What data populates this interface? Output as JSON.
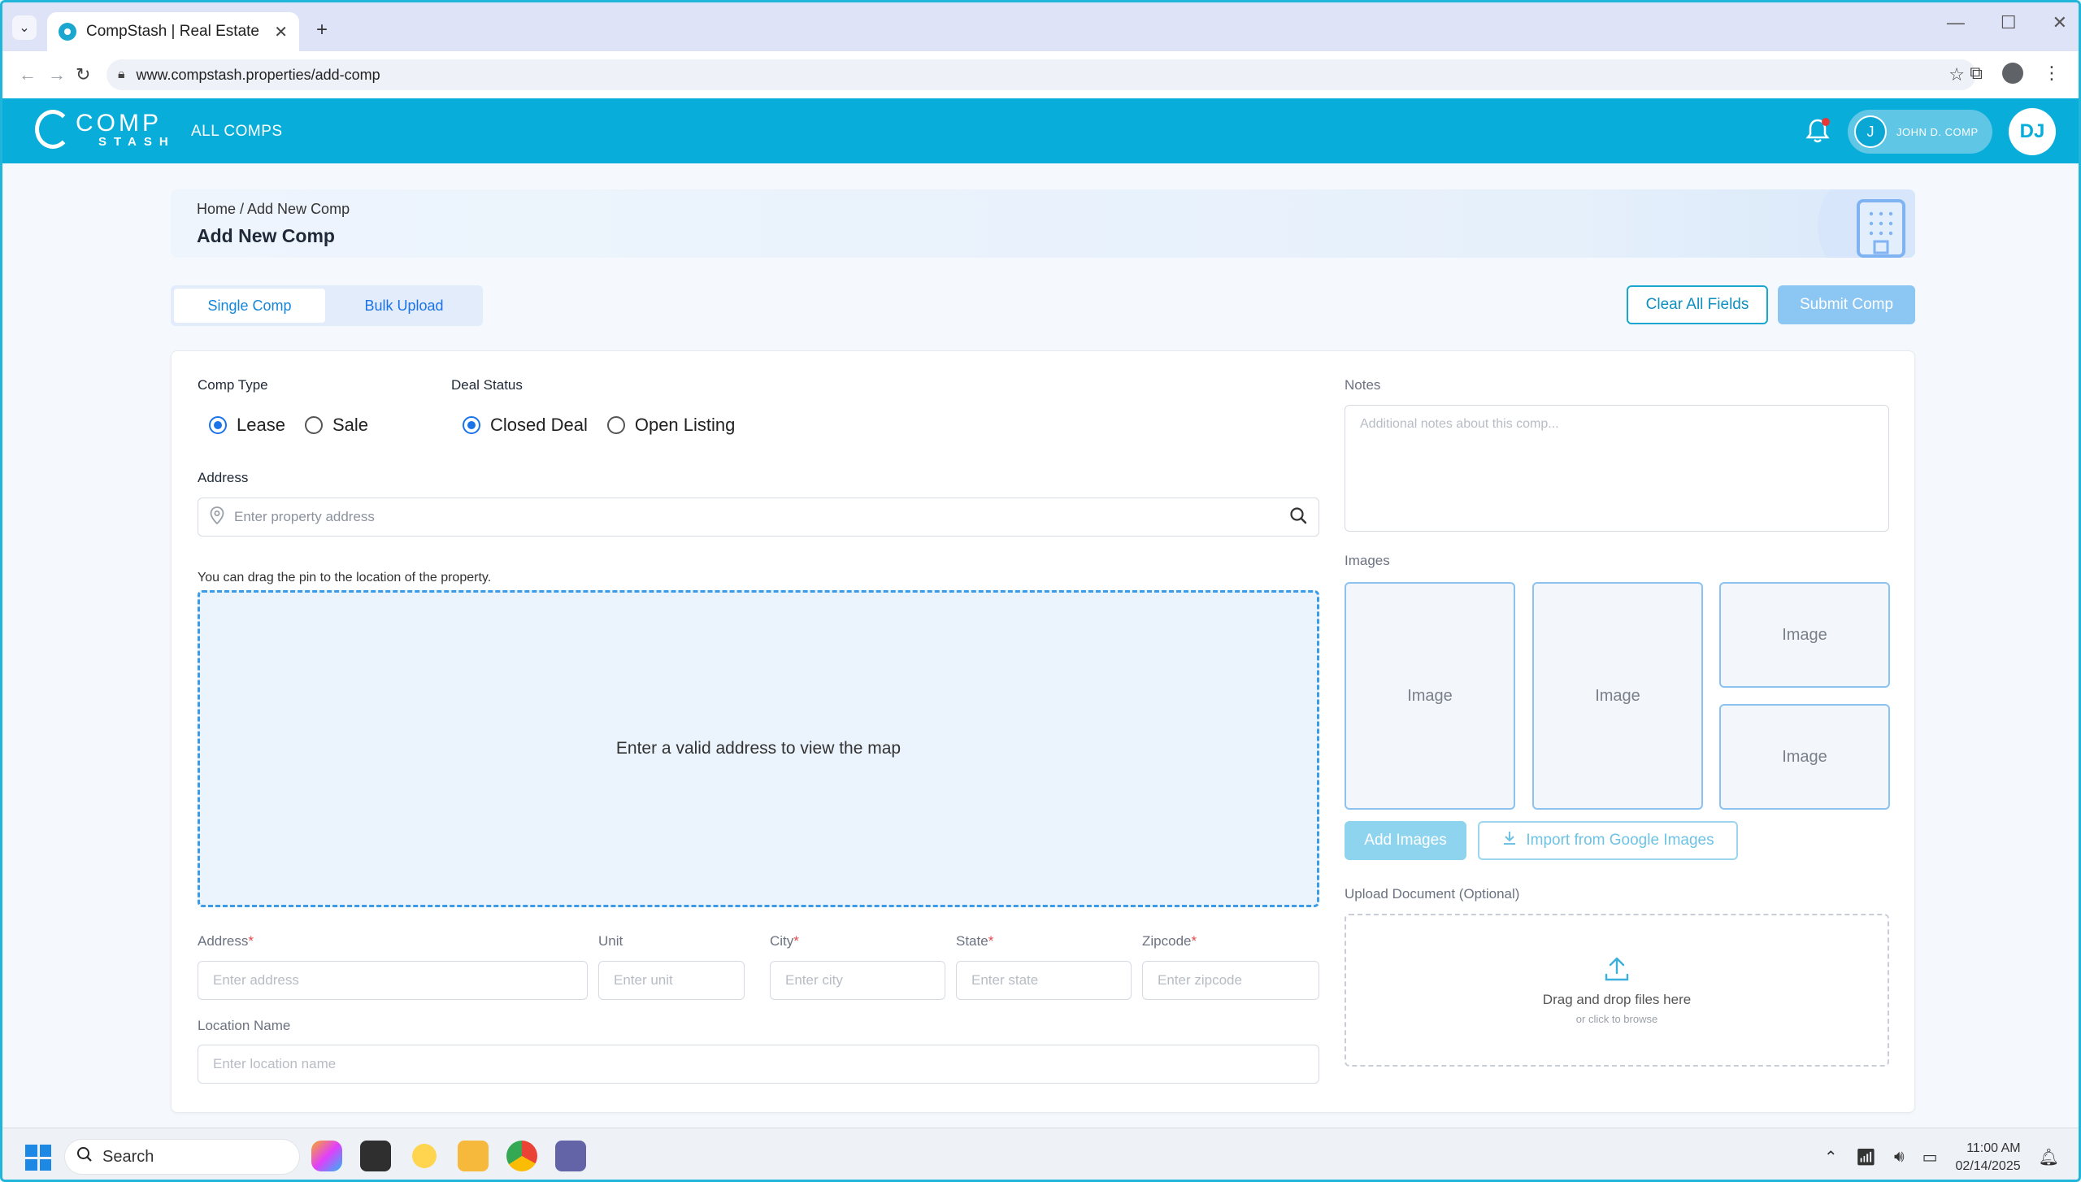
{
  "browser": {
    "tab_title": "CompStash | Real Estate",
    "url": "www.compstash.properties/add-comp"
  },
  "appbar": {
    "logo_top": "COMP",
    "logo_bottom": "STASH",
    "nav_all_comps": "ALL COMPS",
    "user_pill_initial": "J",
    "user_pill_name": "JOHN D. COMP",
    "avatar_initials": "DJ"
  },
  "page": {
    "breadcrumb": "Home / Add New Comp",
    "title": "Add New Comp"
  },
  "mode_toggle": {
    "single": "Single Comp",
    "bulk": "Bulk Upload",
    "active": "single"
  },
  "actions": {
    "clear": "Clear All Fields",
    "submit": "Submit Comp"
  },
  "form": {
    "comp_type_label": "Comp Type",
    "comp_type_options": [
      "Lease",
      "Sale"
    ],
    "comp_type_selected": "Lease",
    "deal_status_label": "Deal Status",
    "deal_status_options": [
      "Closed Deal",
      "Open Listing"
    ],
    "deal_status_selected": "Closed Deal",
    "address_label": "Address",
    "address_placeholder": "Enter property address",
    "map_hint": "You can drag the pin to the location of the property.",
    "map_placeholder": "Enter a valid address to view the map",
    "fields": {
      "address": {
        "label": "Address",
        "placeholder": "Enter address",
        "required": true
      },
      "unit": {
        "label": "Unit",
        "placeholder": "Enter unit",
        "required": false
      },
      "city": {
        "label": "City",
        "placeholder": "Enter city",
        "required": true
      },
      "state": {
        "label": "State",
        "placeholder": "Enter state",
        "required": true
      },
      "zipcode": {
        "label": "Zipcode",
        "placeholder": "Enter zipcode",
        "required": true
      }
    },
    "location_name_label": "Location Name",
    "location_name_placeholder": "Enter location name",
    "notes_label": "Notes",
    "notes_placeholder": "Additional notes about this comp...",
    "images_label": "Images",
    "image_tile_label": "Image",
    "add_images": "Add Images",
    "import_google": "Import from Google Images",
    "upload_label": "Upload Document (Optional)",
    "upload_title": "Drag and drop files here",
    "upload_sub": "or click to browse"
  },
  "taskbar": {
    "search": "Search",
    "time": "11:00 AM",
    "date": "02/14/2025"
  },
  "colors": {
    "brand": "#08aed9",
    "primary": "#1a73e8",
    "submit_disabled": "#8cc6f3",
    "required": "#e34a4a"
  }
}
